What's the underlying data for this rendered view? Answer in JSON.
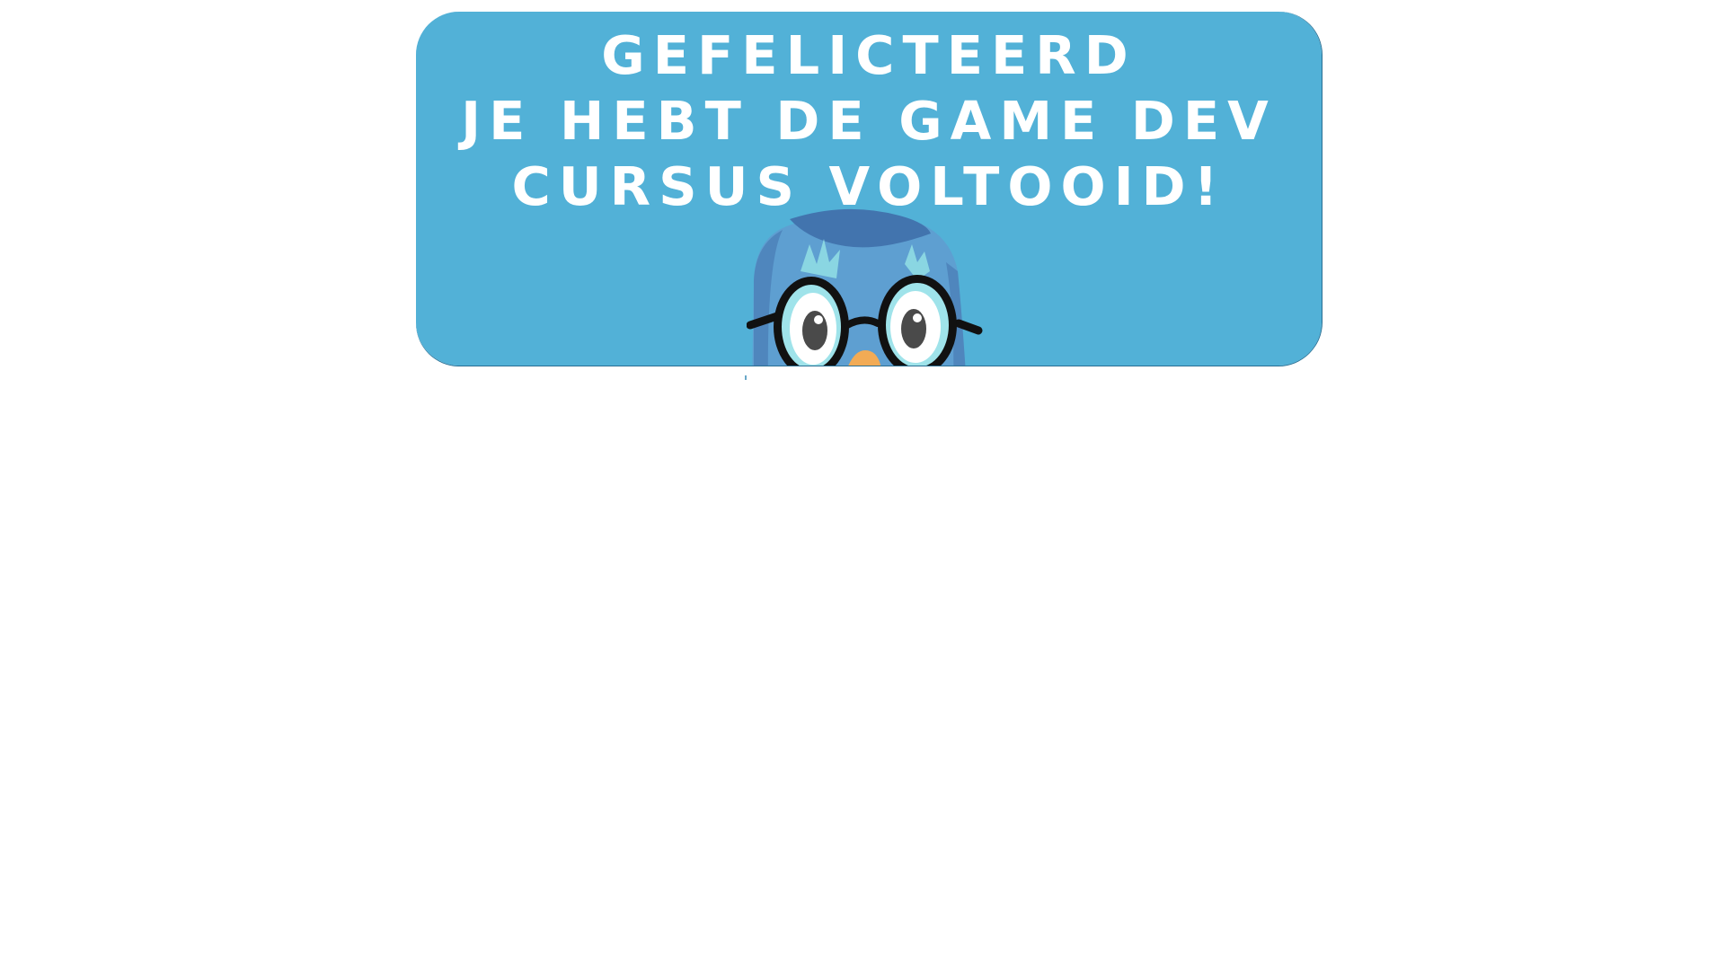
{
  "banner": {
    "title_lines": [
      "GEFELICTEERD",
      "JE HEBT DE GAME DEV",
      "CURSUS VOLTOOID!"
    ],
    "background_color": "#52b1d7",
    "text_color": "#ffffff"
  },
  "mascot": {
    "icon": "owl-with-glasses-icon",
    "body_color": "#5d9fd0",
    "head_color": "#4377b0",
    "beak_color": "#f0a94e"
  }
}
